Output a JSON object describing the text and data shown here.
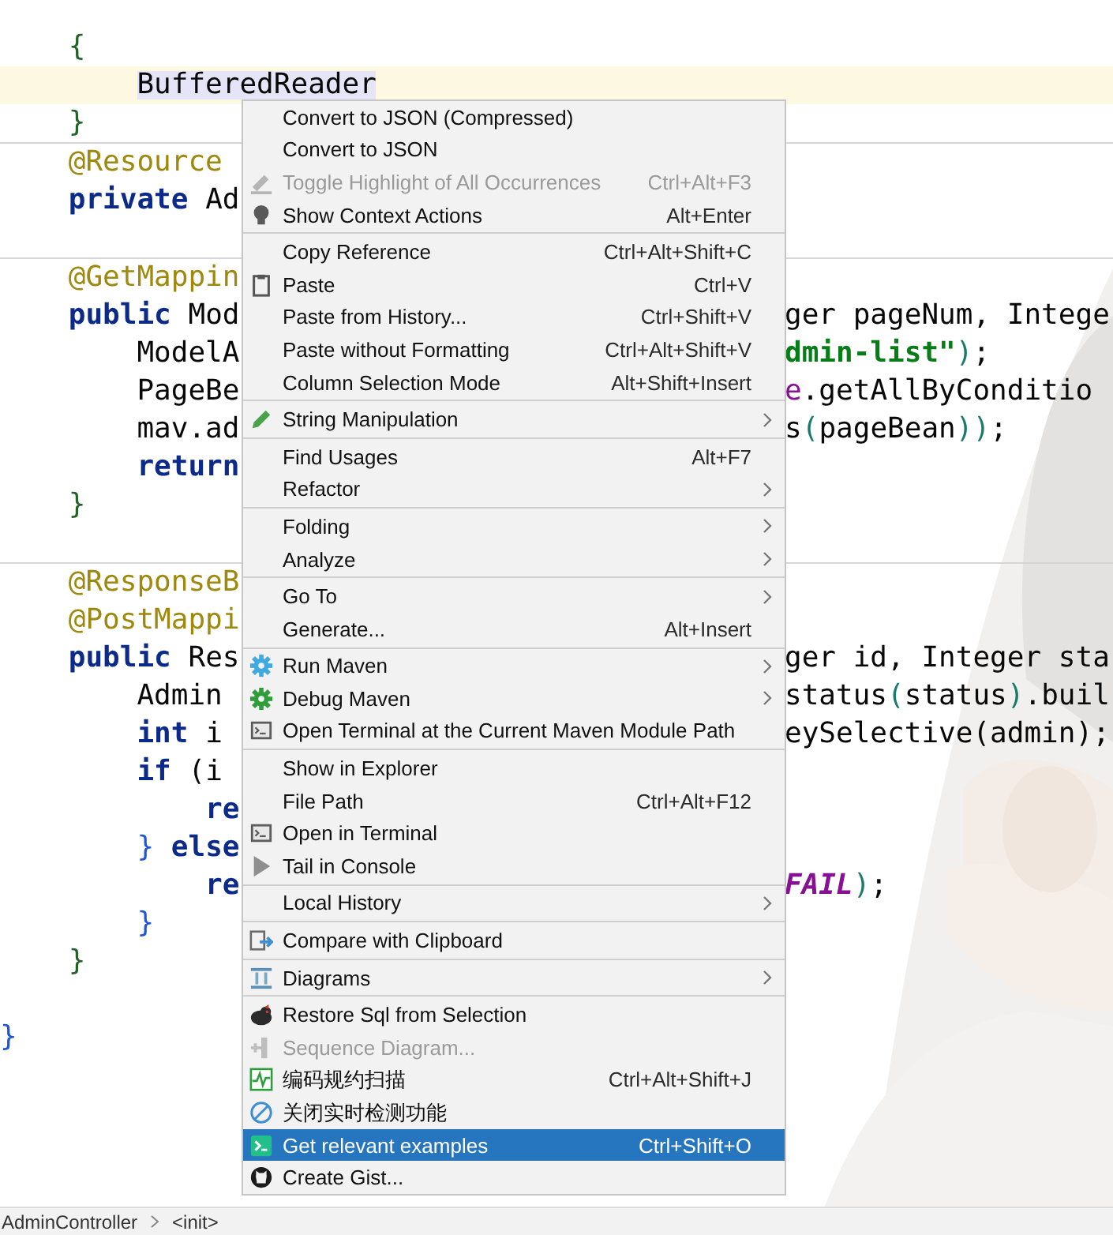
{
  "editor": {
    "blocks": [
      {
        "lines": [
          {
            "current": false,
            "left": [
              {
                "t": "    {",
                "kind": "brace_outer"
              }
            ]
          },
          {
            "current": true,
            "left": [
              {
                "t": "        BufferedReader",
                "kind": "occurrence"
              }
            ]
          },
          {
            "current": false,
            "left": [
              {
                "t": "    }",
                "kind": "brace_outer"
              }
            ]
          }
        ]
      },
      {
        "lines": [
          {
            "current": false,
            "left": [
              {
                "t": "    @Resource",
                "kind": "annotation"
              }
            ]
          },
          {
            "current": false,
            "left": [
              {
                "t": "    private",
                "kind": "keyword"
              },
              {
                "t": " Ad",
                "kind": "plain"
              }
            ]
          },
          {
            "current": false
          }
        ]
      },
      {
        "lines": [
          {
            "current": false,
            "left": [
              {
                "t": "    @GetMappin",
                "kind": "annotation"
              }
            ]
          },
          {
            "current": false,
            "left": [
              {
                "t": "    public",
                "kind": "keyword"
              },
              {
                "t": " Mod",
                "kind": "plain"
              }
            ],
            "right": [
              {
                "t": "ger pageNum, Intege",
                "kind": "plain"
              }
            ]
          },
          {
            "current": false,
            "left": [
              {
                "t": "        ModelA",
                "kind": "plain"
              }
            ],
            "right": [
              {
                "t": "dmin-list\"",
                "kind": "string"
              },
              {
                "t": ")",
                "kind": "paren"
              },
              {
                "t": ";",
                "kind": "plain"
              }
            ]
          },
          {
            "current": false,
            "left": [
              {
                "t": "        PageBe",
                "kind": "plain"
              }
            ],
            "right": [
              {
                "t": "e",
                "kind": "field"
              },
              {
                "t": ".getAllByConditio",
                "kind": "plain"
              }
            ]
          },
          {
            "current": false,
            "left": [
              {
                "t": "        mav.ad",
                "kind": "plain"
              }
            ],
            "right": [
              {
                "t": "s",
                "kind": "plain"
              },
              {
                "t": "(",
                "kind": "paren"
              },
              {
                "t": "pageBean",
                "kind": "plain"
              },
              {
                "t": "))",
                "kind": "paren"
              },
              {
                "t": ";",
                "kind": "plain"
              }
            ]
          },
          {
            "current": false,
            "left": [
              {
                "t": "        return",
                "kind": "keyword"
              }
            ]
          },
          {
            "current": false,
            "left": [
              {
                "t": "    }",
                "kind": "brace_outer"
              }
            ]
          },
          {
            "current": false
          }
        ]
      },
      {
        "lines": [
          {
            "current": false,
            "left": [
              {
                "t": "    @ResponseB",
                "kind": "annotation"
              }
            ]
          },
          {
            "current": false,
            "left": [
              {
                "t": "    @PostMappi",
                "kind": "annotation"
              }
            ]
          },
          {
            "current": false,
            "left": [
              {
                "t": "    public",
                "kind": "keyword"
              },
              {
                "t": " Res",
                "kind": "plain"
              }
            ],
            "right": [
              {
                "t": "ger id, Integer sta",
                "kind": "plain"
              }
            ]
          },
          {
            "current": false,
            "left": [
              {
                "t": "        Admin",
                "kind": "plain"
              }
            ],
            "right": [
              {
                "t": "status",
                "kind": "plain"
              },
              {
                "t": "(",
                "kind": "paren"
              },
              {
                "t": "status",
                "kind": "plain"
              },
              {
                "t": ")",
                "kind": "paren"
              },
              {
                "t": ".buil",
                "kind": "plain"
              }
            ]
          },
          {
            "current": false,
            "left": [
              {
                "t": "        int",
                "kind": "keyword"
              },
              {
                "t": " i",
                "kind": "plain"
              }
            ],
            "right": [
              {
                "t": "eySelective(admin);",
                "kind": "plain"
              }
            ]
          },
          {
            "current": false,
            "left": [
              {
                "t": "        if",
                "kind": "keyword"
              },
              {
                "t": " (i",
                "kind": "plain"
              }
            ]
          },
          {
            "current": false,
            "left": [
              {
                "t": "            re",
                "kind": "keyword"
              }
            ]
          },
          {
            "current": false,
            "left": [
              {
                "t": "        }",
                "kind": "brace_inner"
              },
              {
                "t": " else",
                "kind": "keyword"
              }
            ]
          },
          {
            "current": false,
            "left": [
              {
                "t": "            re",
                "kind": "keyword"
              }
            ],
            "right": [
              {
                "t": "FAIL",
                "kind": "constant"
              },
              {
                "t": ")",
                "kind": "paren"
              },
              {
                "t": ";",
                "kind": "plain"
              }
            ]
          },
          {
            "current": false,
            "left": [
              {
                "t": "        }",
                "kind": "brace_inner"
              }
            ]
          },
          {
            "current": false,
            "left": [
              {
                "t": "    }",
                "kind": "brace_outer"
              }
            ]
          },
          {
            "current": false
          },
          {
            "current": false,
            "left": [
              {
                "t": "}",
                "kind": "brace_inner"
              }
            ]
          }
        ]
      }
    ]
  },
  "breadcrumbs": [
    "AdminController",
    "<init>"
  ],
  "menu": {
    "groups": [
      {
        "items": [
          {
            "label": "Convert to JSON (Compressed)",
            "kind": "none",
            "submenu": false,
            "disabled": false,
            "selected": false
          },
          {
            "label": "Convert to JSON",
            "kind": "none",
            "submenu": false,
            "disabled": false,
            "selected": false
          },
          {
            "label": "Toggle Highlight of All Occurrences",
            "shortcut": "Ctrl+Alt+F3",
            "kind": "highlighter",
            "submenu": false,
            "disabled": true,
            "selected": false
          },
          {
            "label": "Show Context Actions",
            "shortcut": "Alt+Enter",
            "kind": "bulb",
            "submenu": false,
            "disabled": false,
            "selected": false
          }
        ]
      },
      {
        "items": [
          {
            "label": "Copy Reference",
            "shortcut": "Ctrl+Alt+Shift+C",
            "kind": "none",
            "submenu": false,
            "disabled": false,
            "selected": false
          },
          {
            "label": "Paste",
            "shortcut": "Ctrl+V",
            "kind": "clipboard",
            "submenu": false,
            "disabled": false,
            "selected": false
          },
          {
            "label": "Paste from History...",
            "shortcut": "Ctrl+Shift+V",
            "kind": "none",
            "submenu": false,
            "disabled": false,
            "selected": false
          },
          {
            "label": "Paste without Formatting",
            "shortcut": "Ctrl+Alt+Shift+V",
            "kind": "none",
            "submenu": false,
            "disabled": false,
            "selected": false
          },
          {
            "label": "Column Selection Mode",
            "shortcut": "Alt+Shift+Insert",
            "kind": "none",
            "submenu": false,
            "disabled": false,
            "selected": false
          }
        ]
      },
      {
        "items": [
          {
            "label": "String Manipulation",
            "kind": "pencil",
            "submenu": true,
            "disabled": false,
            "selected": false
          }
        ]
      },
      {
        "items": [
          {
            "label": "Find Usages",
            "shortcut": "Alt+F7",
            "kind": "none",
            "submenu": false,
            "disabled": false,
            "selected": false
          },
          {
            "label": "Refactor",
            "kind": "none",
            "submenu": true,
            "disabled": false,
            "selected": false
          }
        ]
      },
      {
        "items": [
          {
            "label": "Folding",
            "kind": "none",
            "submenu": true,
            "disabled": false,
            "selected": false
          },
          {
            "label": "Analyze",
            "kind": "none",
            "submenu": true,
            "disabled": false,
            "selected": false
          }
        ]
      },
      {
        "items": [
          {
            "label": "Go To",
            "kind": "none",
            "submenu": true,
            "disabled": false,
            "selected": false
          },
          {
            "label": "Generate...",
            "shortcut": "Alt+Insert",
            "kind": "none",
            "submenu": false,
            "disabled": false,
            "selected": false
          }
        ]
      },
      {
        "items": [
          {
            "label": "Run Maven",
            "kind": "gear_run",
            "submenu": true,
            "disabled": false,
            "selected": false
          },
          {
            "label": "Debug Maven",
            "kind": "gear_debug",
            "submenu": true,
            "disabled": false,
            "selected": false
          },
          {
            "label": "Open Terminal at the Current Maven Module Path",
            "kind": "terminal",
            "submenu": false,
            "disabled": false,
            "selected": false
          }
        ]
      },
      {
        "items": [
          {
            "label": "Show in Explorer",
            "kind": "none",
            "submenu": false,
            "disabled": false,
            "selected": false
          },
          {
            "label": "File Path",
            "shortcut": "Ctrl+Alt+F12",
            "kind": "none",
            "submenu": false,
            "disabled": false,
            "selected": false
          },
          {
            "label": "Open in Terminal",
            "kind": "terminal",
            "submenu": false,
            "disabled": false,
            "selected": false
          },
          {
            "label": "Tail in Console",
            "kind": "play",
            "submenu": false,
            "disabled": false,
            "selected": false
          }
        ]
      },
      {
        "items": [
          {
            "label": "Local History",
            "kind": "none",
            "submenu": true,
            "disabled": false,
            "selected": false
          }
        ]
      },
      {
        "items": [
          {
            "label": "Compare with Clipboard",
            "kind": "compare",
            "submenu": false,
            "disabled": false,
            "selected": false
          }
        ]
      },
      {
        "items": [
          {
            "label": "Diagrams",
            "kind": "diagram",
            "submenu": true,
            "disabled": false,
            "selected": false
          }
        ]
      },
      {
        "items": [
          {
            "label": "Restore Sql from Selection",
            "kind": "bird",
            "submenu": false,
            "disabled": false,
            "selected": false
          },
          {
            "label": "Sequence Diagram...",
            "kind": "sequence",
            "submenu": false,
            "disabled": true,
            "selected": false
          },
          {
            "label": "编码规约扫描",
            "shortcut": "Ctrl+Alt+Shift+J",
            "kind": "scan",
            "submenu": false,
            "disabled": false,
            "selected": false
          },
          {
            "label": "关闭实时检测功能",
            "kind": "forbid",
            "submenu": false,
            "disabled": false,
            "selected": false
          },
          {
            "label": "Get relevant examples",
            "shortcut": "Ctrl+Shift+O",
            "kind": "examples",
            "submenu": false,
            "disabled": false,
            "selected": true
          },
          {
            "label": "Create Gist...",
            "kind": "github",
            "submenu": false,
            "disabled": false,
            "selected": false
          }
        ]
      }
    ]
  }
}
